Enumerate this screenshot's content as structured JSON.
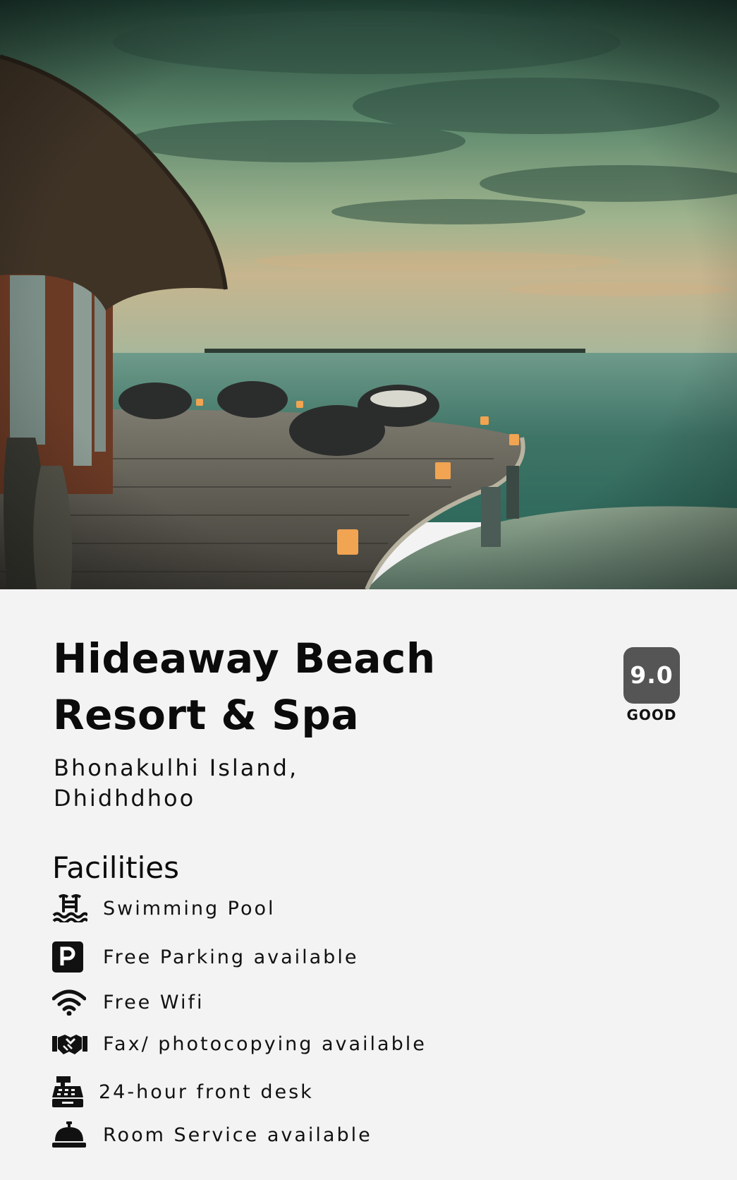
{
  "hero": {
    "image_alt": "resort-deck-sunset-photo"
  },
  "hotel": {
    "name_line1": "Hideaway Beach",
    "name_line2": "Resort & Spa",
    "address_line1": "Bhonakulhi Island,",
    "address_line2": "Dhidhdhoo"
  },
  "rating": {
    "score": "9.0",
    "label": "GOOD",
    "box_color": "#555555"
  },
  "facilities": {
    "heading": "Facilities",
    "items": [
      {
        "icon": "swimming-pool-icon",
        "label": "Swimming Pool"
      },
      {
        "icon": "parking-icon",
        "label": "Free Parking available"
      },
      {
        "icon": "wifi-icon",
        "label": "Free Wifi"
      },
      {
        "icon": "handshake-icon",
        "label": "Fax/ photocopying available"
      },
      {
        "icon": "cash-register-icon",
        "label": "24-hour front desk"
      },
      {
        "icon": "concierge-bell-icon",
        "label": "Room Service available"
      }
    ]
  }
}
